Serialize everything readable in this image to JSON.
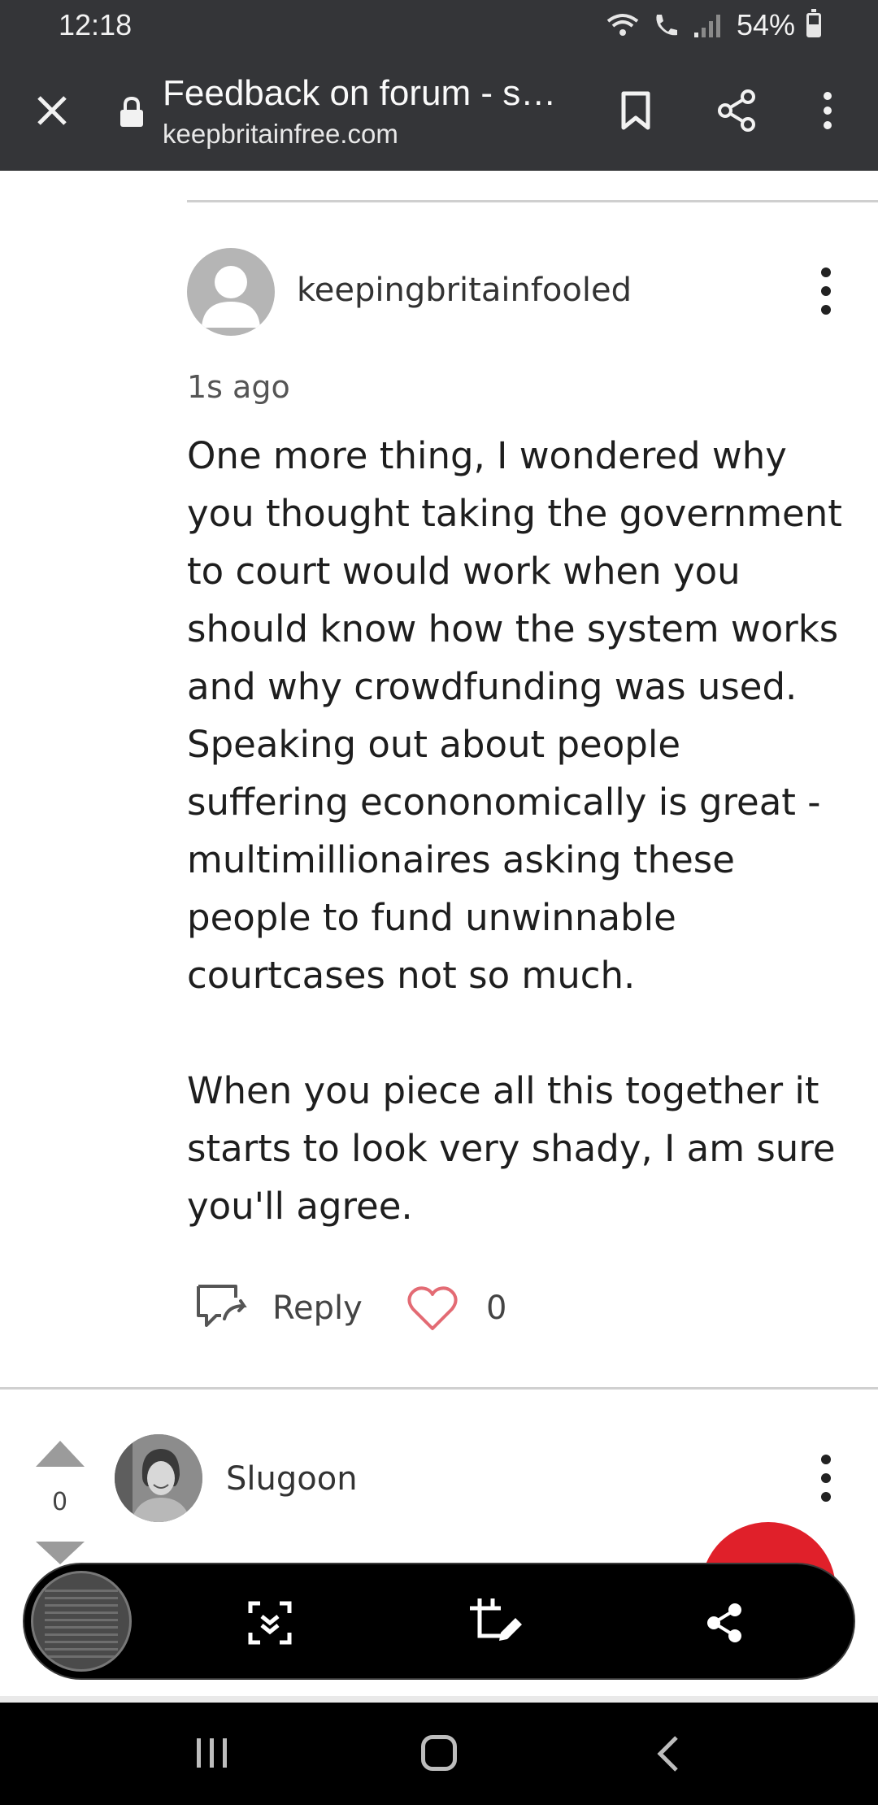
{
  "status_bar": {
    "time": "12:18",
    "battery": "54%",
    "battery_level": 0.54,
    "icons": [
      "wifi-calling-icon",
      "volte-call-icon",
      "signal-icon",
      "battery-icon"
    ]
  },
  "browser": {
    "page_title": "Feedback on forum - s…",
    "url": "keepbritainfree.com",
    "icons": [
      "close-icon",
      "lock-icon",
      "bookmark-icon",
      "share-icon",
      "more-vert-icon"
    ]
  },
  "comment": {
    "username": "keepingbritainfooled",
    "timestamp": "1s ago",
    "body_paragraphs": [
      "One more thing, I wondered why you thought taking the government to court would work when you should know how the system works and why crowdfunding was used. Speaking out about people suffering econonomically is great - multimillionaires asking these people to fund unwinnable courtcases not so much.",
      "When you piece all this together it starts to look very shady, I am sure you'll agree."
    ],
    "reply_label": "Reply",
    "like_count": "0"
  },
  "next_comment": {
    "username": "Slugoon",
    "vote_count": "0"
  },
  "screenshot_toolbar": {
    "icons": [
      "screenshot-thumbnail",
      "scroll-capture-icon",
      "crop-edit-icon",
      "share-icon"
    ]
  },
  "nav_bar": {
    "icons": [
      "recents-icon",
      "home-icon",
      "back-icon"
    ]
  },
  "colors": {
    "toolbar_bg": "#343538",
    "heart": "#e36b74",
    "fab": "#e0202a"
  }
}
